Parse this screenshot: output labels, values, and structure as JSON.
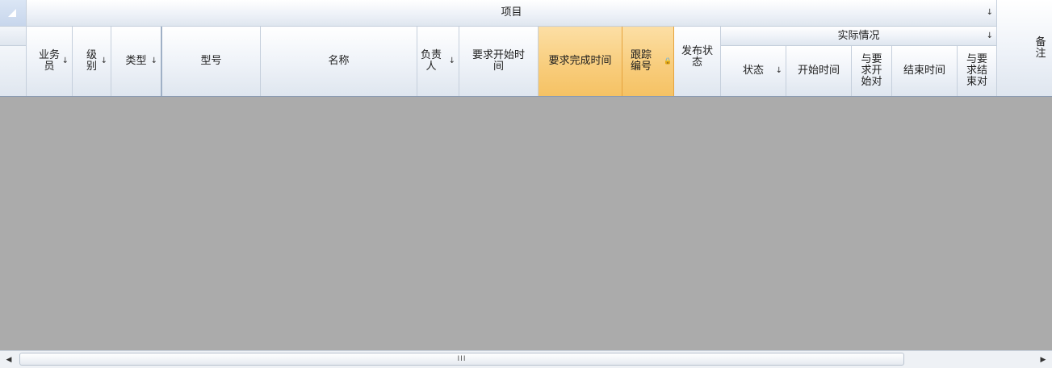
{
  "grid": {
    "group_project": "项目",
    "group_actual": "实际情况",
    "col_salesperson": "业务\n员",
    "col_level": "级\n别",
    "col_type": "类型",
    "col_model": "型号",
    "col_name": "名称",
    "col_owner": "负责\n人",
    "col_req_start": "要求开始时\n间",
    "col_req_finish": "要求完成时间",
    "col_tracking_no": "跟踪\n编号",
    "col_publish_status": "发布状\n态",
    "col_status": "状态",
    "col_start_time": "开始时间",
    "col_vs_req_start": "与要\n求开\n始对",
    "col_end_time": "结束时间",
    "col_vs_req_end": "与要\n求结\n束对",
    "col_remarks": "备注"
  },
  "icons": {
    "sort": "↓",
    "lock": "🔒",
    "scroll_left": "◀",
    "scroll_right": "▶",
    "thumb_grip": "III"
  },
  "colors": {
    "header_bg": "#eef2f8",
    "selected_header": "#f8cc7a",
    "empty_area": "#ababab"
  }
}
